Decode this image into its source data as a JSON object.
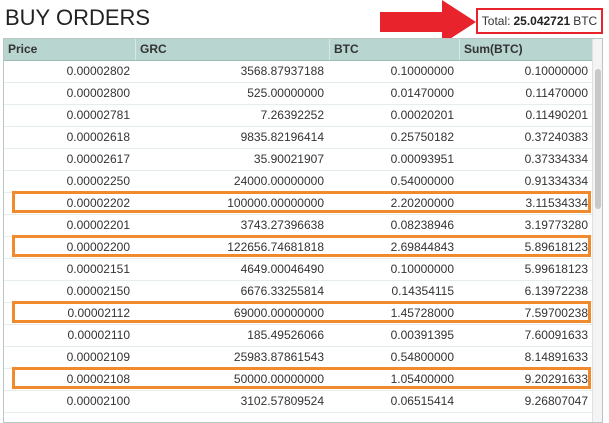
{
  "page_title": "BUY ORDERS",
  "total": {
    "label": "Total:",
    "value": "25.042721",
    "unit": "BTC"
  },
  "colors": {
    "accent_red": "#e8232b",
    "highlight_orange": "#f08a2c",
    "header_bg": "#b8d6cf"
  },
  "table": {
    "columns": [
      "Price",
      "GRC",
      "BTC",
      "Sum(BTC)"
    ],
    "rows": [
      [
        "0.00002802",
        "3568.87937188",
        "0.10000000",
        "0.10000000"
      ],
      [
        "0.00002800",
        "525.00000000",
        "0.01470000",
        "0.11470000"
      ],
      [
        "0.00002781",
        "7.26392252",
        "0.00020201",
        "0.11490201"
      ],
      [
        "0.00002618",
        "9835.82196414",
        "0.25750182",
        "0.37240383"
      ],
      [
        "0.00002617",
        "35.90021907",
        "0.00093951",
        "0.37334334"
      ],
      [
        "0.00002250",
        "24000.00000000",
        "0.54000000",
        "0.91334334"
      ],
      [
        "0.00002202",
        "100000.00000000",
        "2.20200000",
        "3.11534334"
      ],
      [
        "0.00002201",
        "3743.27396638",
        "0.08238946",
        "3.19773280"
      ],
      [
        "0.00002200",
        "122656.74681818",
        "2.69844843",
        "5.89618123"
      ],
      [
        "0.00002151",
        "4649.00046490",
        "0.10000000",
        "5.99618123"
      ],
      [
        "0.00002150",
        "6676.33255814",
        "0.14354115",
        "6.13972238"
      ],
      [
        "0.00002112",
        "69000.00000000",
        "1.45728000",
        "7.59700238"
      ],
      [
        "0.00002110",
        "185.49526066",
        "0.00391395",
        "7.60091633"
      ],
      [
        "0.00002109",
        "25983.87861543",
        "0.54800000",
        "8.14891633"
      ],
      [
        "0.00002108",
        "50000.00000000",
        "1.05400000",
        "9.20291633"
      ],
      [
        "0.00002100",
        "3102.57809524",
        "0.06515414",
        "9.26807047"
      ]
    ]
  }
}
